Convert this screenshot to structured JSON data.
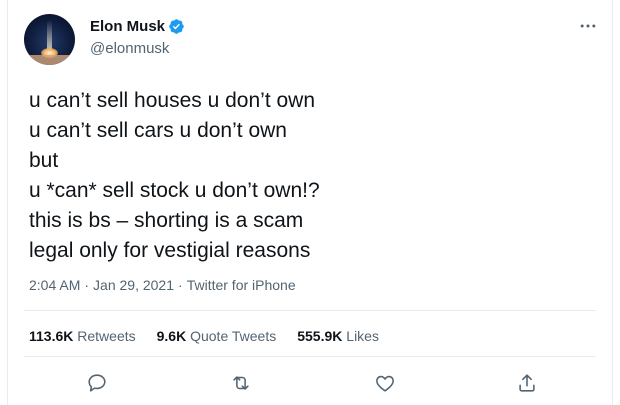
{
  "user": {
    "display_name": "Elon Musk",
    "handle": "@elonmusk"
  },
  "tweet": {
    "lines": [
      "u can’t sell houses u don’t own",
      "u can’t sell cars u don’t own",
      "but",
      "u *can* sell stock u don’t own!?",
      "this is bs – shorting is a scam",
      "legal only for vestigial reasons"
    ],
    "time": "2:04 AM",
    "date": "Jan 29, 2021",
    "source": "Twitter for iPhone",
    "separator": "·"
  },
  "stats": {
    "retweets_count": "113.6K",
    "retweets_label": "Retweets",
    "quotes_count": "9.6K",
    "quotes_label": "Quote Tweets",
    "likes_count": "555.9K",
    "likes_label": "Likes"
  },
  "icons": {
    "verified": "verified-badge-icon",
    "more": "more-options-icon",
    "reply": "reply-icon",
    "retweet": "retweet-icon",
    "like": "heart-icon",
    "share": "share-icon"
  },
  "colors": {
    "verified_blue": "#1d9bf0",
    "icon_gray": "#536471",
    "text": "#0f1419"
  }
}
